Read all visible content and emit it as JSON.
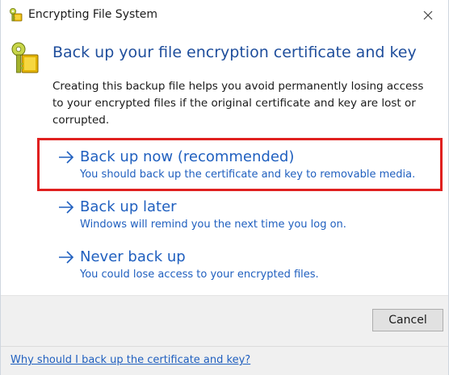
{
  "window": {
    "title": "Encrypting File System",
    "icon": "key-lock-icon",
    "close_icon": "close-icon"
  },
  "header": {
    "title": "Back up your file encryption certificate and key",
    "description": "Creating this backup file helps you avoid permanently losing access to your encrypted files if the original certificate and key are lost or corrupted."
  },
  "options": [
    {
      "title": "Back up now (recommended)",
      "description": "You should back up the certificate and key to removable media.",
      "highlighted": true
    },
    {
      "title": "Back up later",
      "description": "Windows will remind you the next time you log on."
    },
    {
      "title": "Never back up",
      "description": "You could lose access to your encrypted files."
    }
  ],
  "footer": {
    "cancel_label": "Cancel",
    "help_link": "Why should I back up the certificate and key?"
  },
  "colors": {
    "link_blue": "#1f5fbf",
    "title_blue": "#1f4e9c",
    "highlight_red": "#e0201f",
    "footer_bg": "#f0f0f0"
  }
}
